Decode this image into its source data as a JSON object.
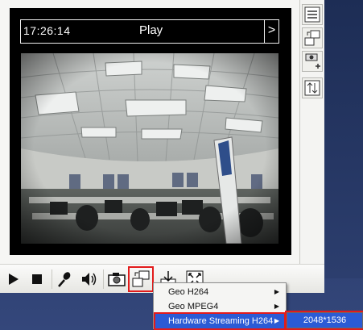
{
  "video": {
    "timestamp": "17:26:14",
    "status": "Play",
    "status_arrow": ">"
  },
  "side_toolbar": {
    "items": [
      {
        "name": "list-view-icon"
      },
      {
        "name": "swap-stream-icon"
      },
      {
        "name": "ptz-camera-icon"
      },
      {
        "name": "sync-icon"
      }
    ]
  },
  "bottom_toolbar": {
    "items": [
      "play-icon",
      "stop-icon",
      "microphone-icon",
      "speaker-icon",
      "snapshot-icon",
      "stream-switch-icon",
      "export-icon",
      "fullscreen-icon"
    ]
  },
  "stream_menu": {
    "items": [
      {
        "label": "Geo H264",
        "arrow": "▶"
      },
      {
        "label": "Geo MPEG4",
        "arrow": "▶"
      },
      {
        "label": "Hardware Streaming H264",
        "arrow": "▶"
      }
    ],
    "submenu_value": "2048*1536"
  },
  "colors": {
    "highlight": "#e21b1b",
    "menu_selected": "#2b5bd5",
    "background": "#2a3b6a"
  }
}
